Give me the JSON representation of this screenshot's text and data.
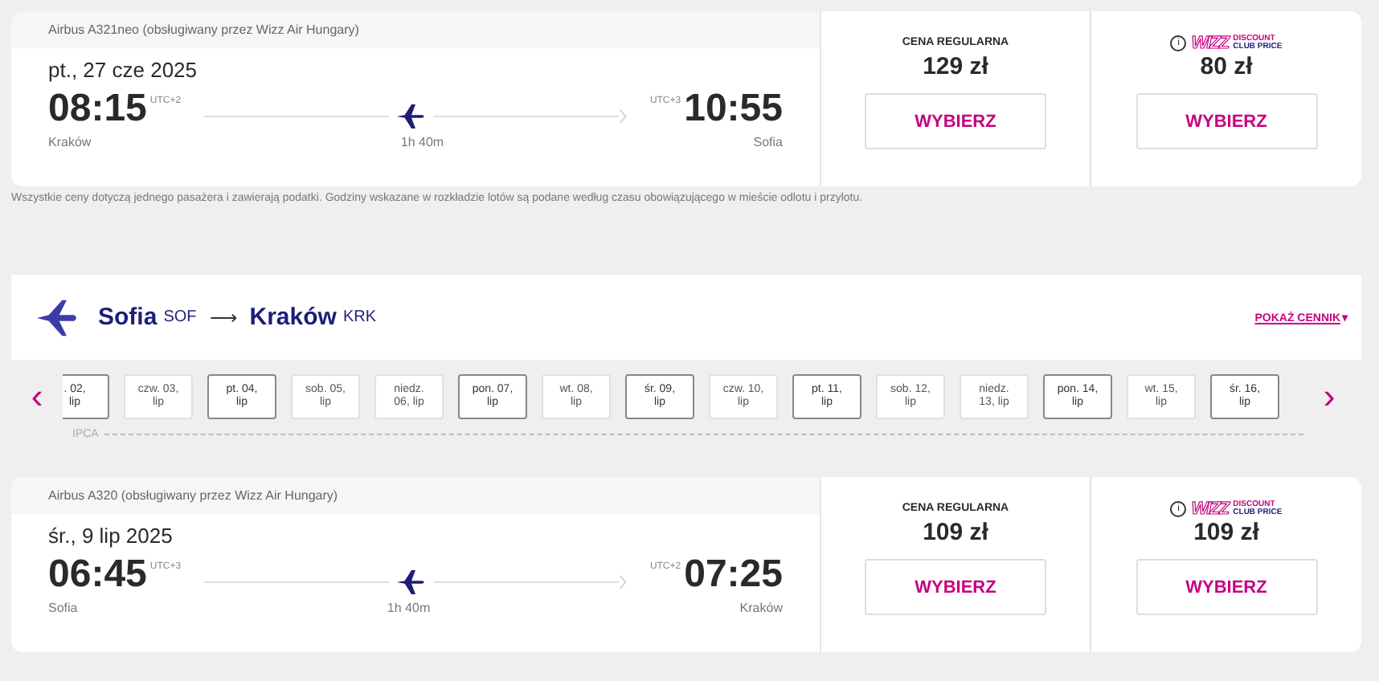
{
  "flights_top": [
    {
      "aircraft": "Airbus A321neo (obsługiwany przez Wizz Air Hungary)",
      "date": "pt., 27 cze 2025",
      "dep_time": "08:15",
      "dep_tz": "UTC+2",
      "arr_time": "10:55",
      "arr_tz": "UTC+3",
      "duration": "1h 40m",
      "from": "Kraków",
      "to": "Sofia",
      "regular": {
        "label": "CENA REGULARNA",
        "price": "129 zł",
        "button": "WYBIERZ"
      },
      "club": {
        "info": "i",
        "logo": "WIZZ",
        "line1": "DISCOUNT",
        "line2": "CLUB PRICE",
        "price": "80 zł",
        "button": "WYBIERZ"
      }
    }
  ],
  "note": "Wszystkie ceny dotyczą jednego pasażera i zawierają podatki. Godziny wskazane w rozkładzie lotów są podane według czasu obowiązującego w mieście odlotu i przylotu.",
  "route": {
    "from_city": "Sofia",
    "from_code": "SOF",
    "arrow": "⟶",
    "to_city": "Kraków",
    "to_code": "KRK",
    "link": "POKAŻ CENNIK",
    "link_caret": "▾"
  },
  "date_strip": {
    "prev": "‹",
    "next": "›",
    "month": "IPCA",
    "days": [
      {
        "lines": [
          ". 02,",
          "lip"
        ],
        "available": true
      },
      {
        "lines": [
          "czw. 03,",
          "lip"
        ],
        "available": false
      },
      {
        "lines": [
          "pt. 04,",
          "lip"
        ],
        "available": true
      },
      {
        "lines": [
          "sob. 05,",
          "lip"
        ],
        "available": false
      },
      {
        "lines": [
          "niedz.",
          "06, lip"
        ],
        "available": false
      },
      {
        "lines": [
          "pon. 07,",
          "lip"
        ],
        "available": true
      },
      {
        "lines": [
          "wt. 08,",
          "lip"
        ],
        "available": false
      },
      {
        "lines": [
          "śr. 09,",
          "lip"
        ],
        "available": true
      },
      {
        "lines": [
          "czw. 10,",
          "lip"
        ],
        "available": false
      },
      {
        "lines": [
          "pt. 11,",
          "lip"
        ],
        "available": true
      },
      {
        "lines": [
          "sob. 12,",
          "lip"
        ],
        "available": false
      },
      {
        "lines": [
          "niedz.",
          "13, lip"
        ],
        "available": false
      },
      {
        "lines": [
          "pon. 14,",
          "lip"
        ],
        "available": true
      },
      {
        "lines": [
          "wt. 15,",
          "lip"
        ],
        "available": false
      },
      {
        "lines": [
          "śr. 16,",
          "lip"
        ],
        "available": true
      }
    ]
  },
  "flights_bottom": [
    {
      "aircraft": "Airbus A320 (obsługiwany przez Wizz Air Hungary)",
      "date": "śr., 9 lip 2025",
      "dep_time": "06:45",
      "dep_tz": "UTC+3",
      "arr_time": "07:25",
      "arr_tz": "UTC+2",
      "duration": "1h 40m",
      "from": "Sofia",
      "to": "Kraków",
      "regular": {
        "label": "CENA REGULARNA",
        "price": "109 zł",
        "button": "WYBIERZ"
      },
      "club": {
        "info": "i",
        "logo": "WIZZ",
        "line1": "DISCOUNT",
        "line2": "CLUB PRICE",
        "price": "109 zł",
        "button": "WYBIERZ"
      }
    }
  ]
}
